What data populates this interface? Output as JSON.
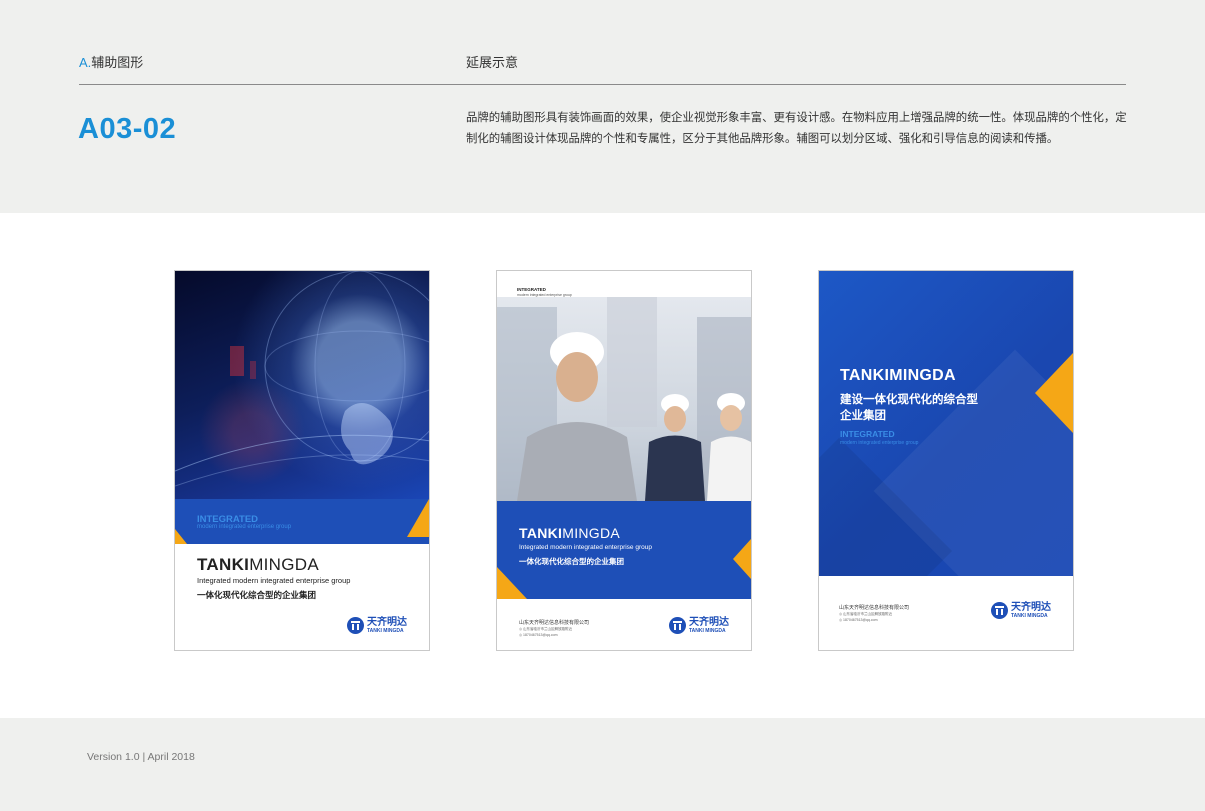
{
  "header": {
    "section_prefix": "A.",
    "section_label": "辅助图形",
    "extension_label": "延展示意",
    "code": "A03-02",
    "description": "品牌的辅助图形具有装饰画面的效果，使企业视觉形象丰富、更有设计感。在物料应用上增强品牌的统一性。体现品牌的个性化，定制化的辅图设计体现品牌的个性和专属性，区分于其他品牌形象。辅图可以划分区域、强化和引导信息的阅读和传播。"
  },
  "cards": [
    {
      "band_tag": "INTEGRATED",
      "band_sub": "modern integrated enterprise group",
      "brand_bold": "TANKI",
      "brand_light": "MINGDA",
      "tagline_en": "Integrated modern integrated enterprise group",
      "tagline_cn": "一体化现代化综合型的企业集团",
      "logo_cn": "天齐明达",
      "logo_en": "TANKI MINGDA"
    },
    {
      "small_tag": "INTEGRATED",
      "small_sub": "modern integrated enterprise group",
      "brand_bold": "TANKI",
      "brand_light": "MINGDA",
      "tagline_en": "Integrated modern integrated enterprise group",
      "tagline_cn": "一体化现代化综合型的企业集团",
      "corp": "山东天齐明达信息科技有限公司",
      "address": "◎ 山东省临沂市兰山区解放路附近",
      "phone": "◎ 1870467513@qq.com",
      "logo_cn": "天齐明达",
      "logo_en": "TANKI MINGDA"
    },
    {
      "brand": "TANKIMINGDA",
      "cn_line1": "建设一体化现代化的综合型",
      "cn_line2": "企业集团",
      "tag": "INTEGRATED",
      "sub": "modern integrated enterprise group",
      "corp": "山东天齐明达信息科技有限公司",
      "address": "◎ 山东省临沂市兰山区解放路附近",
      "phone": "◎ 1870467513@qq.com",
      "logo_cn": "天齐明达",
      "logo_en": "TANKI MINGDA"
    }
  ],
  "footer": {
    "version": "Version 1.0  |  April 2018"
  },
  "colors": {
    "accent": "#1a8fd6",
    "brand_blue": "#1e4fb7",
    "brand_orange": "#f5a716"
  }
}
